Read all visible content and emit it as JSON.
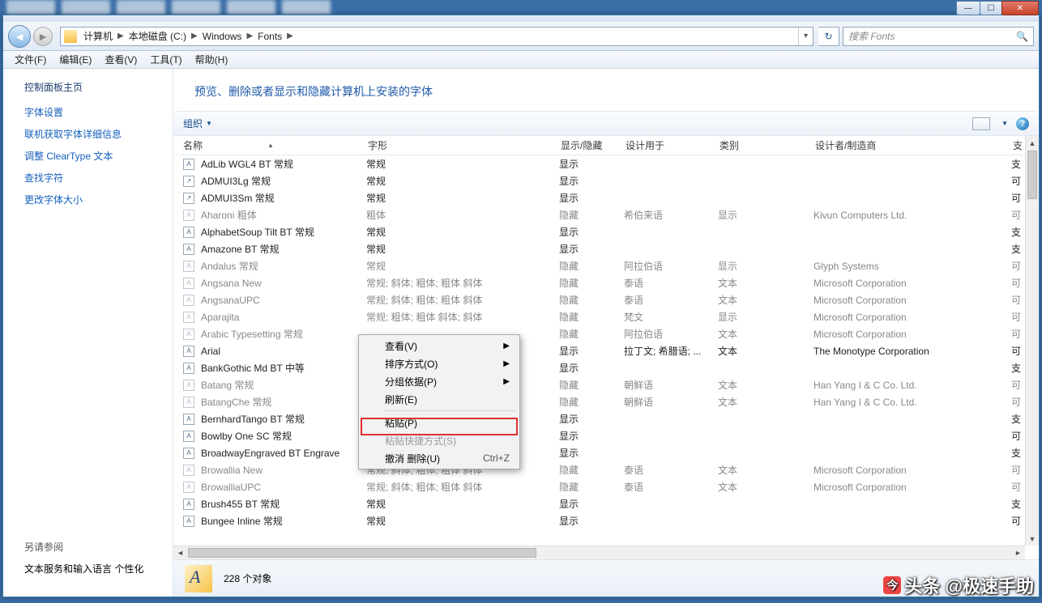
{
  "window_controls": {
    "min": "—",
    "max": "☐",
    "close": "✕"
  },
  "breadcrumb": {
    "items": [
      "计算机",
      "本地磁盘 (C:)",
      "Windows",
      "Fonts"
    ]
  },
  "search": {
    "placeholder": "搜索 Fonts"
  },
  "menu": {
    "items": [
      "文件(F)",
      "编辑(E)",
      "查看(V)",
      "工具(T)",
      "帮助(H)"
    ]
  },
  "sidebar": {
    "home": "控制面板主页",
    "links": [
      "字体设置",
      "联机获取字体详细信息",
      "调整 ClearType 文本",
      "查找字符",
      "更改字体大小"
    ],
    "see_also_label": "另请参阅",
    "see_also": [
      "文本服务和输入语言",
      "个性化"
    ]
  },
  "main": {
    "title": "预览、删除或者显示和隐藏计算机上安装的字体",
    "organize": "组织"
  },
  "columns": {
    "name": "名称",
    "style": "字形",
    "showhide": "显示/隐藏",
    "designed_for": "设计用于",
    "category": "类别",
    "designer": "设计者/制造商",
    "extra": "支"
  },
  "rows": [
    {
      "ic": "A",
      "name": "AdLib WGL4 BT 常规",
      "style": "常规",
      "sh": "显示",
      "df": "",
      "cat": "",
      "dm": "",
      "ex": "支",
      "hidden": false,
      "stack": false
    },
    {
      "ic": "↗",
      "name": "ADMUI3Lg 常规",
      "style": "常规",
      "sh": "显示",
      "df": "",
      "cat": "",
      "dm": "",
      "ex": "可",
      "hidden": false,
      "stack": false
    },
    {
      "ic": "↗",
      "name": "ADMUI3Sm 常规",
      "style": "常规",
      "sh": "显示",
      "df": "",
      "cat": "",
      "dm": "",
      "ex": "可",
      "hidden": false,
      "stack": false
    },
    {
      "ic": "A",
      "name": "Aharoni 粗体",
      "style": "粗体",
      "sh": "隐藏",
      "df": "希伯来语",
      "cat": "显示",
      "dm": "Kivun Computers Ltd.",
      "ex": "可",
      "hidden": true,
      "stack": false
    },
    {
      "ic": "A",
      "name": "AlphabetSoup Tilt BT 常规",
      "style": "常规",
      "sh": "显示",
      "df": "",
      "cat": "",
      "dm": "",
      "ex": "支",
      "hidden": false,
      "stack": false
    },
    {
      "ic": "A",
      "name": "Amazone BT 常规",
      "style": "常规",
      "sh": "显示",
      "df": "",
      "cat": "",
      "dm": "",
      "ex": "支",
      "hidden": false,
      "stack": false
    },
    {
      "ic": "A",
      "name": "Andalus 常规",
      "style": "常规",
      "sh": "隐藏",
      "df": "阿拉伯语",
      "cat": "显示",
      "dm": "Glyph Systems",
      "ex": "可",
      "hidden": true,
      "stack": false
    },
    {
      "ic": "A",
      "name": "Angsana New",
      "style": "常规; 斜体; 粗体; 粗体 斜体",
      "sh": "隐藏",
      "df": "泰语",
      "cat": "文本",
      "dm": "Microsoft Corporation",
      "ex": "可",
      "hidden": true,
      "stack": true
    },
    {
      "ic": "A",
      "name": "AngsanaUPC",
      "style": "常规; 斜体; 粗体; 粗体 斜体",
      "sh": "隐藏",
      "df": "泰语",
      "cat": "文本",
      "dm": "Microsoft Corporation",
      "ex": "可",
      "hidden": true,
      "stack": true
    },
    {
      "ic": "A",
      "name": "Aparajita",
      "style": "常规; 粗体; 粗体 斜体; 斜体",
      "sh": "隐藏",
      "df": "梵文",
      "cat": "显示",
      "dm": "Microsoft Corporation",
      "ex": "可",
      "hidden": true,
      "stack": true
    },
    {
      "ic": "A",
      "name": "Arabic Typesetting 常规",
      "style": "",
      "sh": "隐藏",
      "df": "阿拉伯语",
      "cat": "文本",
      "dm": "Microsoft Corporation",
      "ex": "可",
      "hidden": true,
      "stack": false
    },
    {
      "ic": "A",
      "name": "Arial",
      "style": "",
      "sh": "显示",
      "df": "拉丁文; 希腊语; ...",
      "cat": "文本",
      "dm": "The Monotype Corporation",
      "ex": "可",
      "hidden": false,
      "stack": true
    },
    {
      "ic": "A",
      "name": "BankGothic Md BT 中等",
      "style": "",
      "sh": "显示",
      "df": "",
      "cat": "",
      "dm": "",
      "ex": "支",
      "hidden": false,
      "stack": false
    },
    {
      "ic": "A",
      "name": "Batang 常规",
      "style": "",
      "sh": "隐藏",
      "df": "朝鲜语",
      "cat": "文本",
      "dm": "Han Yang I & C Co. Ltd.",
      "ex": "可",
      "hidden": true,
      "stack": false
    },
    {
      "ic": "A",
      "name": "BatangChe 常规",
      "style": "",
      "sh": "隐藏",
      "df": "朝鲜语",
      "cat": "文本",
      "dm": "Han Yang I & C Co. Ltd.",
      "ex": "可",
      "hidden": true,
      "stack": false
    },
    {
      "ic": "A",
      "name": "BernhardTango BT 常规",
      "style": "",
      "sh": "显示",
      "df": "",
      "cat": "",
      "dm": "",
      "ex": "支",
      "hidden": false,
      "stack": false
    },
    {
      "ic": "A",
      "name": "Bowlby One SC 常规",
      "style": "",
      "sh": "显示",
      "df": "",
      "cat": "",
      "dm": "",
      "ex": "可",
      "hidden": false,
      "stack": false
    },
    {
      "ic": "A",
      "name": "BroadwayEngraved BT Engrave",
      "style": "",
      "sh": "显示",
      "df": "",
      "cat": "",
      "dm": "",
      "ex": "支",
      "hidden": false,
      "stack": false
    },
    {
      "ic": "A",
      "name": "Browallia New",
      "style": "常规; 斜体; 粗体; 粗体 斜体",
      "sh": "隐藏",
      "df": "泰语",
      "cat": "文本",
      "dm": "Microsoft Corporation",
      "ex": "可",
      "hidden": true,
      "stack": true
    },
    {
      "ic": "A",
      "name": "BrowalliaUPC",
      "style": "常规; 斜体; 粗体; 粗体 斜体",
      "sh": "隐藏",
      "df": "泰语",
      "cat": "文本",
      "dm": "Microsoft Corporation",
      "ex": "可",
      "hidden": true,
      "stack": true
    },
    {
      "ic": "A",
      "name": "Brush455 BT 常规",
      "style": "常规",
      "sh": "显示",
      "df": "",
      "cat": "",
      "dm": "",
      "ex": "支",
      "hidden": false,
      "stack": false
    },
    {
      "ic": "A",
      "name": "Bungee Inline 常规",
      "style": "常规",
      "sh": "显示",
      "df": "",
      "cat": "",
      "dm": "",
      "ex": "可",
      "hidden": false,
      "stack": false
    }
  ],
  "context_menu": {
    "items": [
      {
        "label": "查看(V)",
        "arrow": true
      },
      {
        "label": "排序方式(O)",
        "arrow": true
      },
      {
        "label": "分组依据(P)",
        "arrow": true
      },
      {
        "label": "刷新(E)"
      },
      {
        "sep": true
      },
      {
        "label": "粘贴(P)",
        "highlight": true
      },
      {
        "label": "粘贴快捷方式(S)",
        "disabled": true
      },
      {
        "label": "撤消 删除(U)",
        "shortcut": "Ctrl+Z"
      }
    ]
  },
  "status": {
    "count": "228 个对象"
  },
  "watermark": {
    "text": "头条 @极速手助"
  }
}
